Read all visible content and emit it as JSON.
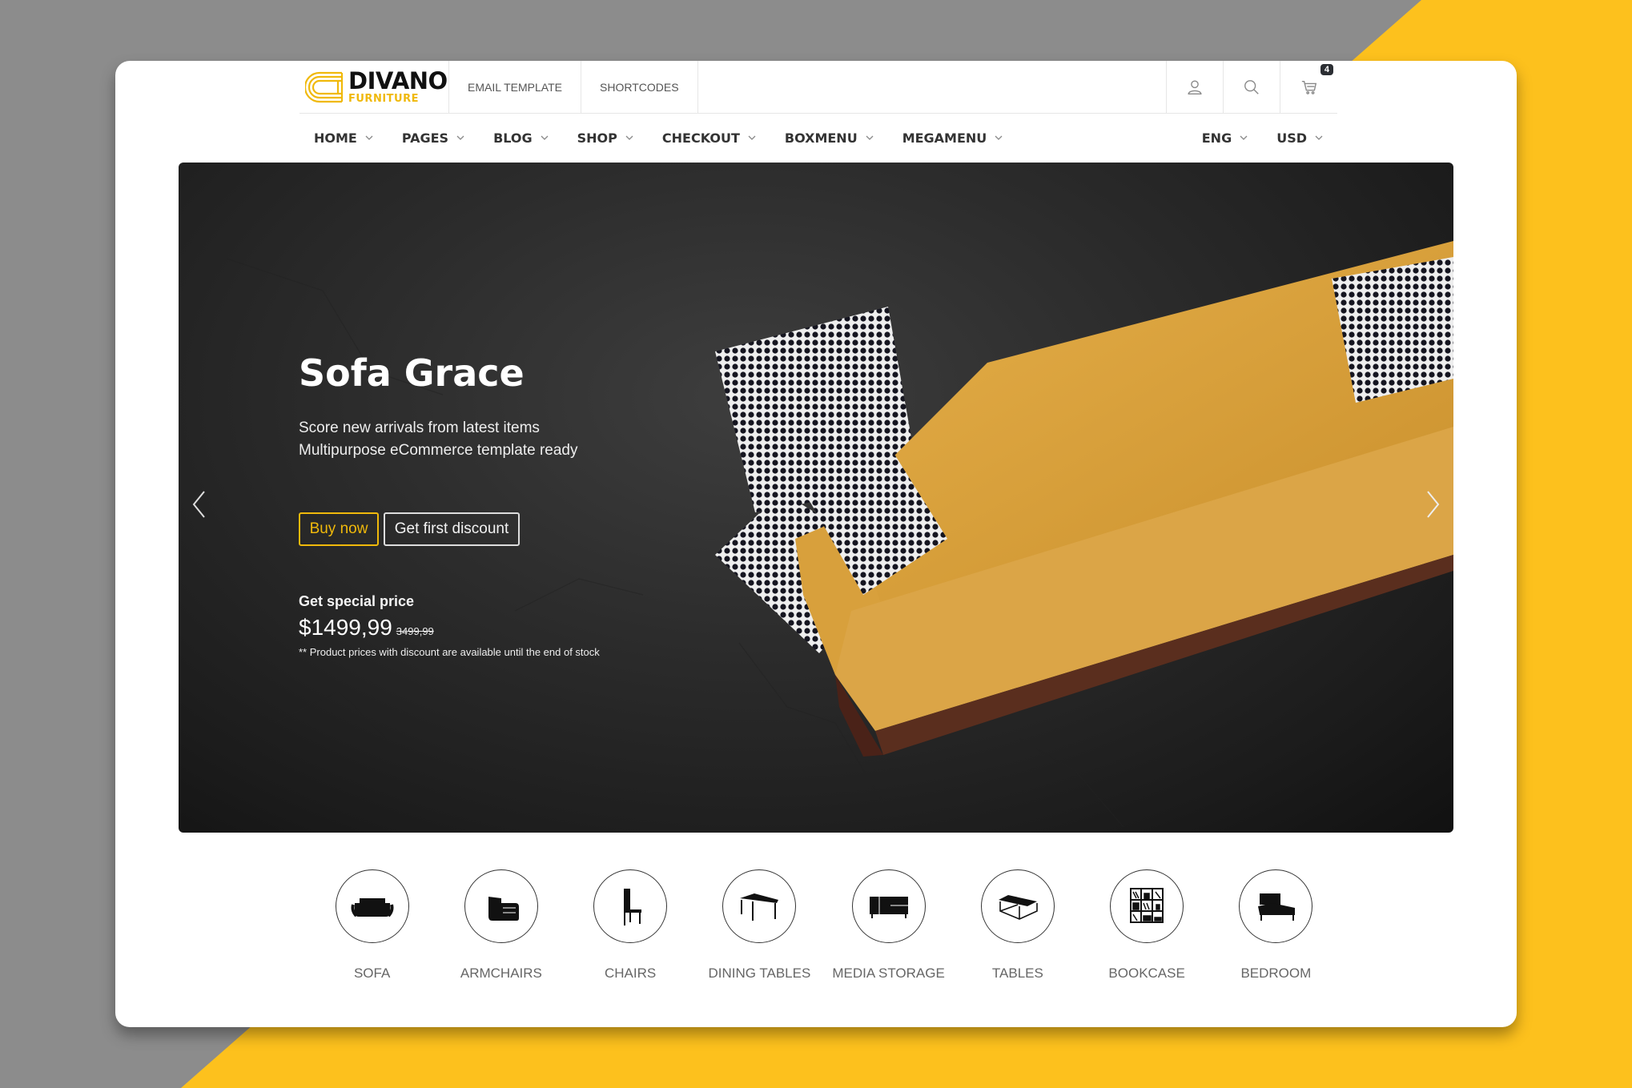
{
  "brand": {
    "name": "DIVANO",
    "tagline": "FURNITURE",
    "accent": "#f0b90b"
  },
  "topbar": {
    "links": [
      "EMAIL TEMPLATE",
      "SHORTCODES"
    ],
    "icons": [
      "user-icon",
      "search-icon",
      "cart-icon"
    ],
    "cart_count": "4"
  },
  "nav": {
    "items": [
      "HOME",
      "PAGES",
      "BLOG",
      "SHOP",
      "CHECKOUT",
      "BOXMENU",
      "MEGAMENU"
    ],
    "language": "ENG",
    "currency": "USD"
  },
  "hero": {
    "title": "Sofa Grace",
    "subtitle_line1": "Score new arrivals from latest items",
    "subtitle_line2": "Multipurpose eCommerce template ready",
    "buy_label": "Buy now",
    "discount_label": "Get first discount",
    "special_label": "Get special price",
    "price_now": "$1499,99",
    "price_old": "3499,99",
    "note": "** Product prices with discount are available until the end of stock"
  },
  "categories": [
    {
      "label": "SOFA",
      "icon": "sofa-icon"
    },
    {
      "label": "ARMCHAIRS",
      "icon": "armchair-icon"
    },
    {
      "label": "CHAIRS",
      "icon": "chair-icon"
    },
    {
      "label": "DINING TABLES",
      "icon": "dining-table-icon"
    },
    {
      "label": "MEDIA STORAGE",
      "icon": "media-storage-icon"
    },
    {
      "label": "TABLES",
      "icon": "table-icon"
    },
    {
      "label": "BOOKCASE",
      "icon": "bookcase-icon"
    },
    {
      "label": "BEDROOM",
      "icon": "bed-icon"
    }
  ],
  "colors": {
    "background_grey": "#8c8c8c",
    "background_yellow": "#fdc11d",
    "sofa": "#d9a13a"
  }
}
